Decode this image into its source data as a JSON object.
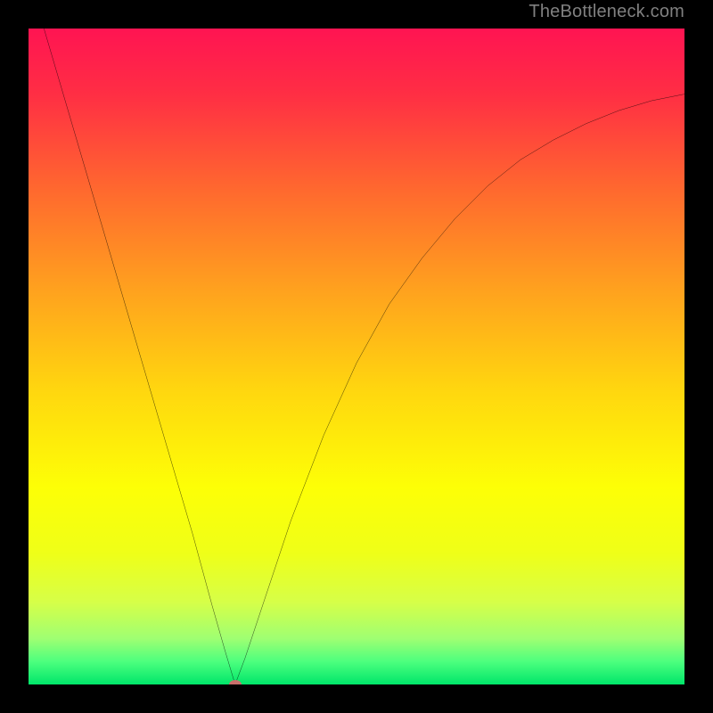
{
  "watermark": "TheBottleneck.com",
  "chart_data": {
    "type": "line",
    "title": "",
    "xlabel": "",
    "ylabel": "",
    "xlim": [
      0,
      100
    ],
    "ylim": [
      0,
      100
    ],
    "grid": false,
    "series": [
      {
        "name": "bottleneck-curve",
        "x": [
          0,
          5,
          10,
          15,
          20,
          25,
          28,
          30,
          31.5,
          33,
          36,
          40,
          45,
          50,
          55,
          60,
          65,
          70,
          75,
          80,
          85,
          90,
          95,
          100
        ],
        "y": [
          108,
          91,
          74,
          57,
          40,
          23,
          12,
          5,
          0,
          4,
          13,
          25,
          38,
          49,
          58,
          65,
          71,
          76,
          80,
          83,
          85.5,
          87.5,
          89,
          90
        ]
      }
    ],
    "minimum_marker": {
      "x": 31.5,
      "y": 0
    },
    "gradient_stops": [
      {
        "pos": 0.0,
        "color": "#ff1452"
      },
      {
        "pos": 0.1,
        "color": "#ff2e44"
      },
      {
        "pos": 0.25,
        "color": "#ff6a2e"
      },
      {
        "pos": 0.4,
        "color": "#ffa21e"
      },
      {
        "pos": 0.55,
        "color": "#ffd60f"
      },
      {
        "pos": 0.7,
        "color": "#fdff06"
      },
      {
        "pos": 0.8,
        "color": "#efff18"
      },
      {
        "pos": 0.875,
        "color": "#d6ff48"
      },
      {
        "pos": 0.93,
        "color": "#9fff72"
      },
      {
        "pos": 0.965,
        "color": "#4dff7e"
      },
      {
        "pos": 1.0,
        "color": "#00e66a"
      }
    ]
  }
}
